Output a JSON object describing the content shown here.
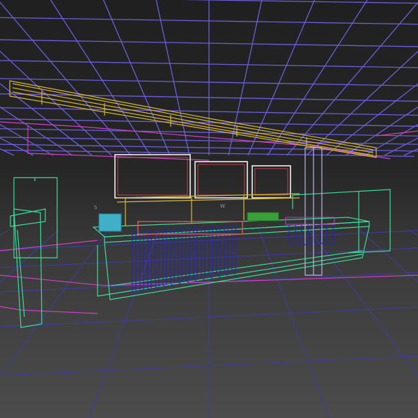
{
  "view": {
    "colors": {
      "background_top": "#202020",
      "background_bottom": "#4c4c4c",
      "ceiling_grid": "#6a5fe0",
      "floor_grid": "#3c3ca8",
      "soffit": "#d8b838",
      "counter": "#3cdc9a",
      "appliances": "#2424c8",
      "equipment": "#e05050",
      "range_hood": "#f0f0f0",
      "column": "#b8b8e8",
      "accent": "#d040c8"
    }
  },
  "labels": {
    "tiny_a": "S",
    "tiny_b": "W"
  }
}
